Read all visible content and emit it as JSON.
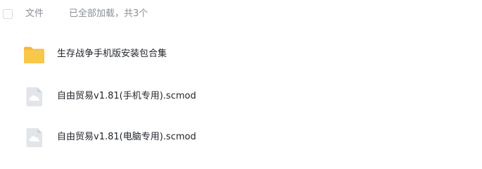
{
  "header": {
    "column_title": "文件",
    "load_status": "已全部加载，共3个"
  },
  "files": [
    {
      "name": "生存战争手机版安装包合集",
      "icon": "folder-icon",
      "icon_color": "#f7c343"
    },
    {
      "name": "自由贸易v1.81(手机专用).scmod",
      "icon": "cloud-file-icon",
      "icon_color": "#d9dde3"
    },
    {
      "name": "自由贸易v1.81(电脑专用).scmod",
      "icon": "cloud-file-icon",
      "icon_color": "#d9dde3"
    }
  ]
}
